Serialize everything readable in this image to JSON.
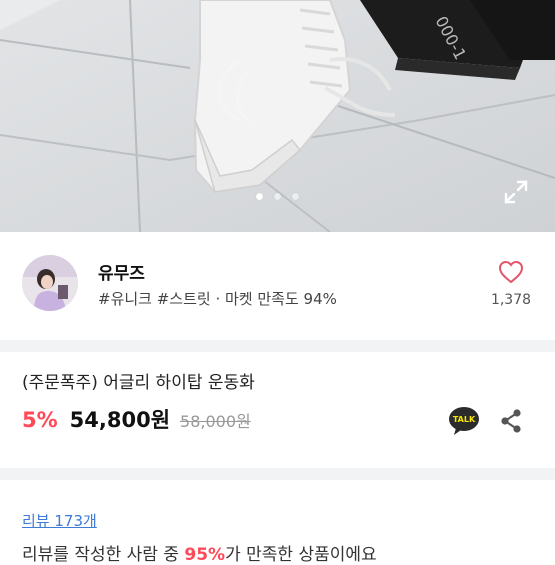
{
  "product_image": {
    "carousel_page": 1,
    "carousel_total": 3,
    "expand_icon": "expand-icon"
  },
  "seller": {
    "name": "유무즈",
    "tags": "#유니크 #스트릿 · 마켓 만족도 94%",
    "likes": "1,378",
    "like_icon": "heart-icon"
  },
  "product": {
    "title": "(주문폭주) 어글리 하이탑 운동화",
    "discount": "5%",
    "price": "54,800원",
    "original_price": "58,000원"
  },
  "actions": {
    "kakaotalk_label": "TALK",
    "share_icon": "share-icon"
  },
  "reviews": {
    "link_label": "리뷰 173개",
    "summary_prefix": "리뷰를 작성한 사람 중 ",
    "summary_percent": "95%",
    "summary_suffix": "가 만족한 상품이에요"
  },
  "colors": {
    "accent_red": "#ff4858",
    "link_blue": "#3d7bd6",
    "heart": "#e2566a"
  }
}
